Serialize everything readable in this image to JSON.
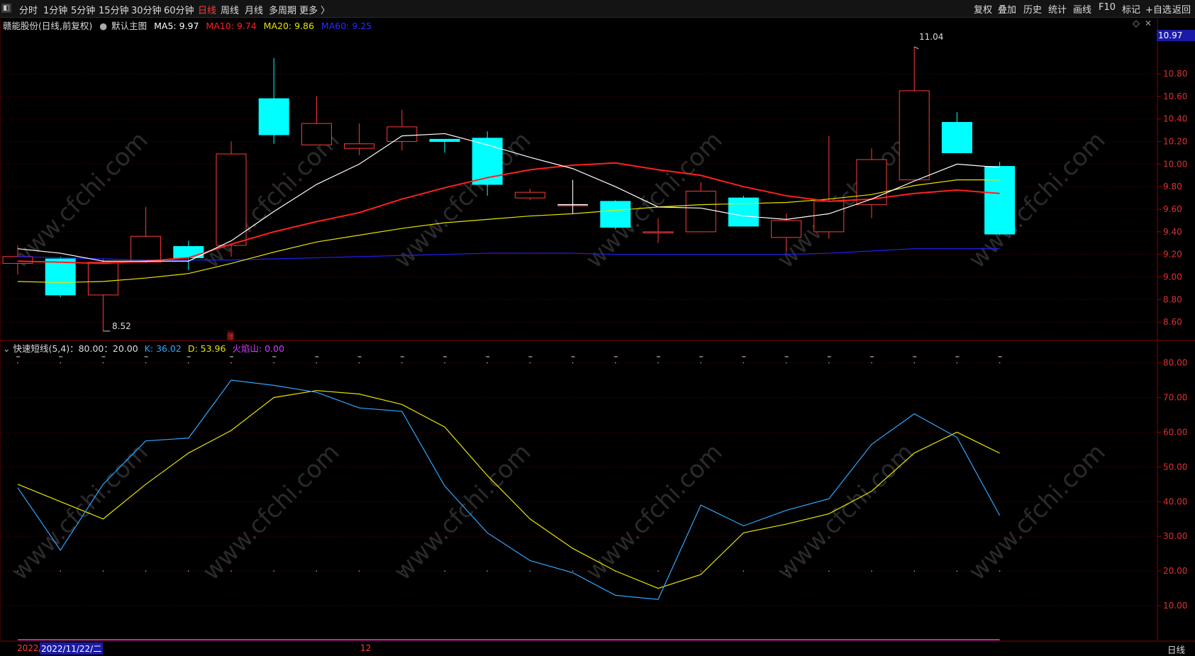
{
  "toolbar": {
    "periods": [
      "分时",
      "1分钟",
      "5分钟",
      "15分钟",
      "30分钟",
      "60分钟",
      "日线",
      "周线",
      "月线",
      "多周期",
      "更多 〉"
    ],
    "active_period": "日线",
    "right_buttons": [
      "复权",
      "叠加",
      "历史",
      "统计",
      "画线",
      "F10",
      "标记",
      "+自选",
      "返回"
    ]
  },
  "main_header": {
    "stock": "赣能股份(日线,前复权)",
    "template": "默认主图",
    "ma5": "MA5: 9.97",
    "ma10": "MA10: 9.74",
    "ma20": "MA20: 9.86",
    "ma60": "MA60: 9.25"
  },
  "price_axis": {
    "current": "10.97",
    "ticks": [
      "10.80",
      "10.60",
      "10.40",
      "10.20",
      "10.00",
      "9.80",
      "9.60",
      "9.40",
      "9.20",
      "9.00",
      "8.80",
      "8.60"
    ]
  },
  "annotations": {
    "high": "11.04",
    "low": "8.52",
    "zhang": "涨"
  },
  "sub_header": {
    "name": "快速短线(5,4)：80.00：20.00",
    "k": "K: 36.02",
    "d": "D: 53.96",
    "fire": "火焰山: 0.00"
  },
  "sub_axis": {
    "ticks": [
      "80.00",
      "70.00",
      "60.00",
      "50.00",
      "40.00",
      "30.00",
      "20.00",
      "10.00"
    ]
  },
  "bottom_bar": {
    "date_left": "2022/",
    "date_selected": "2022/11/22/二",
    "month_mark": "12",
    "period": "日线"
  },
  "colors": {
    "up": "#ff3b3b",
    "down": "#00ffff",
    "ma5": "#ffffff",
    "ma10": "#ff2020",
    "ma20": "#e8e400",
    "ma60": "#2020ff",
    "k": "#2fa8ff",
    "d": "#e8e400",
    "fire": "#d040ff"
  },
  "chart_data": {
    "type": "candlestick",
    "candles": [
      {
        "o": 9.12,
        "h": 9.28,
        "l": 9.02,
        "c": 9.18
      },
      {
        "o": 9.16,
        "h": 9.18,
        "l": 8.82,
        "c": 8.84
      },
      {
        "o": 8.84,
        "h": 9.16,
        "l": 8.52,
        "c": 9.13
      },
      {
        "o": 9.13,
        "h": 9.62,
        "l": 9.12,
        "c": 9.36
      },
      {
        "o": 9.27,
        "h": 9.32,
        "l": 9.06,
        "c": 9.17
      },
      {
        "o": 9.28,
        "h": 10.2,
        "l": 9.18,
        "c": 10.09
      },
      {
        "o": 10.58,
        "h": 10.94,
        "l": 10.18,
        "c": 10.26
      },
      {
        "o": 10.17,
        "h": 10.6,
        "l": 10.17,
        "c": 10.36
      },
      {
        "o": 10.14,
        "h": 10.36,
        "l": 10.08,
        "c": 10.18
      },
      {
        "o": 10.2,
        "h": 10.48,
        "l": 10.12,
        "c": 10.33
      },
      {
        "o": 10.22,
        "h": 10.22,
        "l": 10.1,
        "c": 10.2
      },
      {
        "o": 10.23,
        "h": 10.29,
        "l": 9.72,
        "c": 9.82
      },
      {
        "o": 9.7,
        "h": 9.78,
        "l": 9.68,
        "c": 9.75
      },
      {
        "o": 9.64,
        "h": 9.86,
        "l": 9.56,
        "c": 9.64
      },
      {
        "o": 9.67,
        "h": 9.68,
        "l": 9.42,
        "c": 9.44
      },
      {
        "o": 9.39,
        "h": 9.52,
        "l": 9.3,
        "c": 9.4
      },
      {
        "o": 9.4,
        "h": 9.84,
        "l": 9.4,
        "c": 9.76
      },
      {
        "o": 9.7,
        "h": 9.72,
        "l": 9.45,
        "c": 9.45
      },
      {
        "o": 9.35,
        "h": 9.56,
        "l": 9.22,
        "c": 9.5
      },
      {
        "o": 9.4,
        "h": 10.25,
        "l": 9.34,
        "c": 9.67
      },
      {
        "o": 9.64,
        "h": 10.14,
        "l": 9.52,
        "c": 10.04
      },
      {
        "o": 9.86,
        "h": 11.04,
        "l": 9.86,
        "c": 10.65
      },
      {
        "o": 10.37,
        "h": 10.46,
        "l": 10.1,
        "c": 10.1
      },
      {
        "o": 9.98,
        "h": 10.02,
        "l": 9.37,
        "c": 9.38
      }
    ],
    "ma5": [
      9.25,
      9.21,
      9.14,
      9.14,
      9.14,
      9.32,
      9.58,
      9.82,
      10.0,
      10.25,
      10.27,
      10.17,
      10.06,
      9.96,
      9.8,
      9.62,
      9.61,
      9.54,
      9.51,
      9.56,
      9.69,
      9.85,
      10.0,
      9.97
    ],
    "ma10": [
      9.14,
      9.13,
      9.12,
      9.14,
      9.17,
      9.29,
      9.4,
      9.49,
      9.57,
      9.69,
      9.79,
      9.88,
      9.95,
      9.99,
      10.01,
      9.95,
      9.9,
      9.8,
      9.72,
      9.67,
      9.69,
      9.74,
      9.77,
      9.74
    ],
    "ma20": [
      8.96,
      8.95,
      8.96,
      8.99,
      9.03,
      9.12,
      9.22,
      9.31,
      9.37,
      9.43,
      9.48,
      9.51,
      9.54,
      9.56,
      9.59,
      9.62,
      9.64,
      9.65,
      9.66,
      9.69,
      9.73,
      9.81,
      9.86,
      9.86
    ],
    "ma60": [
      9.18,
      9.17,
      9.16,
      9.15,
      9.15,
      9.15,
      9.16,
      9.17,
      9.18,
      9.19,
      9.2,
      9.21,
      9.21,
      9.21,
      9.2,
      9.2,
      9.2,
      9.2,
      9.2,
      9.21,
      9.23,
      9.25,
      9.25,
      9.25
    ],
    "k": [
      44,
      26,
      45,
      57.5,
      58.3,
      75,
      73.5,
      71.5,
      67,
      66,
      44.5,
      31,
      23,
      19.5,
      13,
      11.8,
      39,
      33,
      37.5,
      40.8,
      56.5,
      65.3,
      58.5,
      36.02
    ],
    "d": [
      45,
      40,
      35,
      45,
      54,
      60.5,
      70,
      72,
      71,
      68,
      61.5,
      47.5,
      35,
      26.5,
      20,
      15,
      19,
      31,
      33.5,
      36.5,
      43,
      54,
      60,
      53.96
    ],
    "fire": [
      0,
      0,
      0,
      0,
      0,
      0,
      0,
      0,
      0,
      0,
      0,
      0,
      0,
      0,
      0,
      0,
      0,
      0,
      0,
      0,
      0,
      0,
      0,
      0
    ],
    "price_range": [
      8.45,
      11.14
    ],
    "kd_range": [
      0,
      84
    ]
  }
}
